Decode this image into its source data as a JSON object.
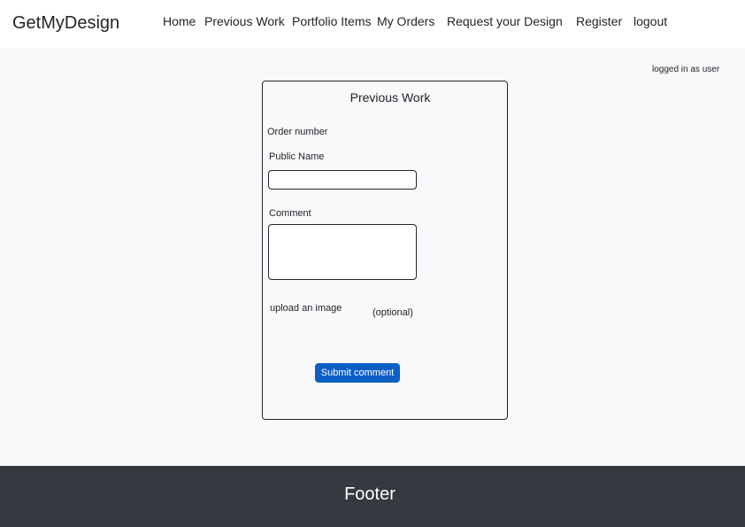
{
  "brand": "GetMyDesign",
  "nav": {
    "home": "Home",
    "previous_work": "Previous Work",
    "portfolio_items": "Portfolio Items",
    "my_orders": "My Orders",
    "request_design": "Request your Design",
    "register": "Register",
    "logout": "logout"
  },
  "status": {
    "logged_in": "logged in as user"
  },
  "form": {
    "title": "Previous Work",
    "order_number_label": "Order number",
    "public_name_label": "Public Name",
    "public_name_value": "",
    "comment_label": "Comment",
    "comment_value": "",
    "upload_label": "upload an image",
    "optional_label": "(optional)",
    "submit_label": "Submit comment"
  },
  "footer": {
    "text": "Footer"
  },
  "colors": {
    "primary_button": "#0d5fc5",
    "footer_bg": "#343a40",
    "page_bg": "#f8f9fa"
  }
}
